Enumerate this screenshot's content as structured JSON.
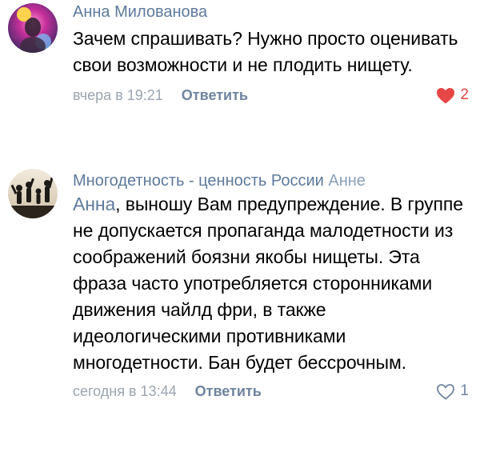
{
  "comments": [
    {
      "author": "Анна Милованова",
      "text": "Зачем спрашивать? Нужно просто оценивать свои возможности и не плодить нищету.",
      "time": "вчера в 19:21",
      "reply_label": "Ответить",
      "likes": "2",
      "liked": true,
      "like_icon": "heart-filled-icon"
    },
    {
      "author": "Многодетность - ценность России",
      "reply_to": "Анне",
      "mention": "Анна",
      "text": ", выношу Вам предупреждение. В группе не допускается пропаганда малодетности из соображений боязни якобы нищеты. Эта фраза часто употребляется сторонниками движения чайлд фри, в также идеологическими противниками многодетности. Бан будет бессрочным.",
      "time": "сегодня в 13:44",
      "reply_label": "Ответить",
      "likes": "1",
      "liked": false,
      "like_icon": "heart-outline-icon"
    }
  ],
  "colors": {
    "author": "#5d7a9c",
    "meta": "#9aa4b0",
    "like_active": "#e64646",
    "like_inactive": "#6f84a0"
  }
}
